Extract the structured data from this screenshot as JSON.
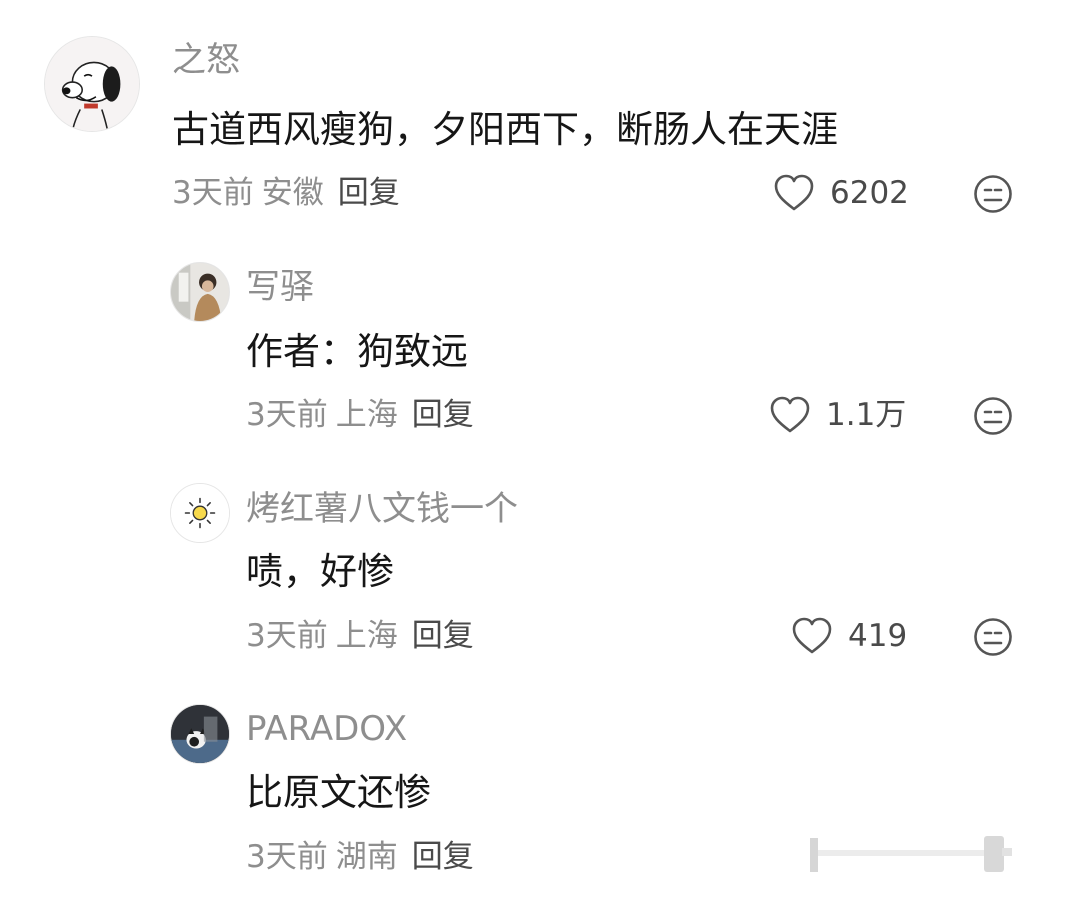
{
  "comments": [
    {
      "author": "之怒",
      "avatar_icon": "snoopy-avatar",
      "text": "古道西风瘦狗，夕阳西下，断肠人在天涯",
      "time": "3天前",
      "location": "安徽",
      "reply_label": "回复",
      "likes": "6202",
      "is_reply": false
    },
    {
      "author": "写驿",
      "avatar_icon": "photo-avatar-person",
      "text": "作者：狗致远",
      "time": "3天前",
      "location": "上海",
      "reply_label": "回复",
      "likes": "1.1万",
      "is_reply": true
    },
    {
      "author": "烤红薯八文钱一个",
      "avatar_icon": "sun-avatar",
      "text": "啧，好惨",
      "time": "3天前",
      "location": "上海",
      "reply_label": "回复",
      "likes": "419",
      "is_reply": true
    },
    {
      "author": "PARADOX",
      "avatar_icon": "photo-avatar-cat",
      "text": "比原文还惨",
      "time": "3天前",
      "location": "湖南",
      "reply_label": "回复",
      "likes": "",
      "is_reply": true
    }
  ],
  "icons": {
    "like": "heart-outline-icon",
    "dislike": "neutral-face-icon"
  },
  "colors": {
    "author": "#8e8e8e",
    "text": "#161616",
    "meta": "#8e8e8e",
    "reply": "#4a4a4a",
    "icon": "#555555"
  }
}
